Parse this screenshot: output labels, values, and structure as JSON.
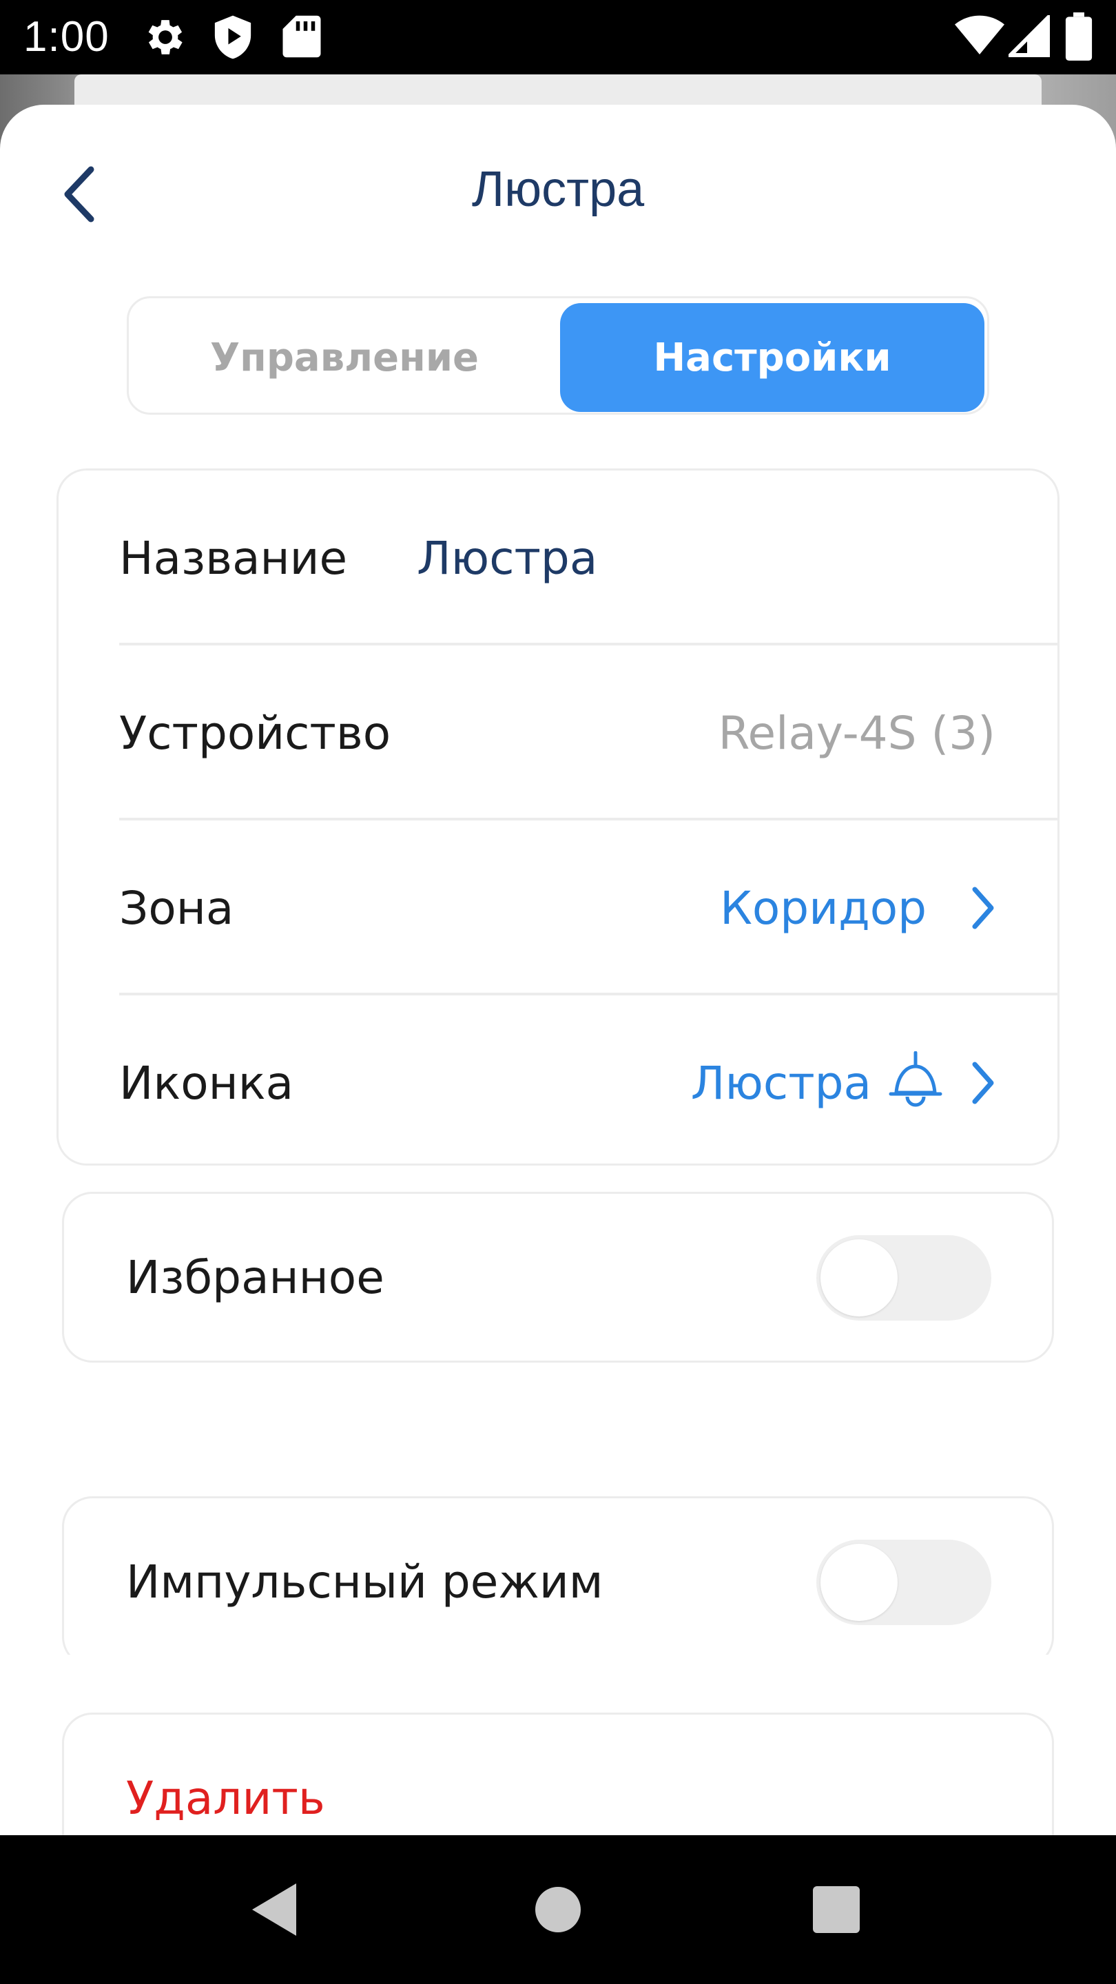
{
  "status_bar": {
    "time": "1:00",
    "left_icons": [
      "gear-icon",
      "shield-play-icon",
      "sd-card-icon"
    ],
    "right_icons": [
      "wifi-icon",
      "signal-icon",
      "battery-icon"
    ]
  },
  "header": {
    "title": "Люстра",
    "back_icon": "chevron-left-icon"
  },
  "tabs": [
    {
      "label": "Управление",
      "active": false
    },
    {
      "label": "Настройки",
      "active": true
    }
  ],
  "settings": {
    "name_label": "Название",
    "name_value": "Люстра",
    "device_label": "Устройство",
    "device_value": "Relay-4S (3)",
    "zone_label": "Зона",
    "zone_value": "Коридор",
    "icon_label": "Иконка",
    "icon_value": "Люстра",
    "icon_preview": "chandelier-icon"
  },
  "toggles": {
    "favorite_label": "Избранное",
    "favorite_on": false,
    "impulse_label": "Импульсный режим",
    "impulse_on": false
  },
  "delete_label": "Удалить",
  "colors": {
    "accent": "#3d96f5",
    "link": "#2b84e0",
    "title": "#1e3a66",
    "danger": "#e0201f",
    "muted": "#a6a6a6"
  },
  "nav_bar": [
    "back-triangle-icon",
    "home-circle-icon",
    "recents-square-icon"
  ]
}
